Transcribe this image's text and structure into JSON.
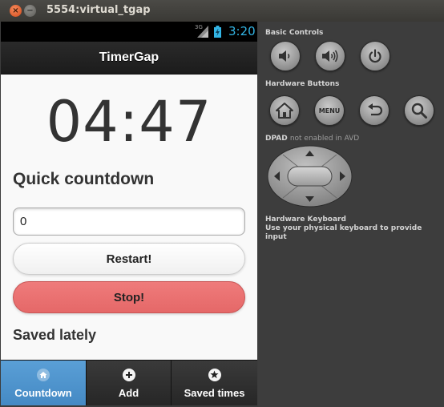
{
  "window": {
    "title": "5554:virtual_tgap",
    "close_glyph": "×",
    "minimize_glyph": "−"
  },
  "statusbar": {
    "network": "3G",
    "time": "3:20",
    "time_color": "#33b5e5"
  },
  "app": {
    "title": "TimerGap",
    "timer": "04:47",
    "quick_title": "Quick countdown",
    "countdown_value": "0",
    "restart_label": "Restart!",
    "stop_label": "Stop!",
    "saved_title": "Saved lately",
    "stop_color": "#e86f6f",
    "active_tab_color": "#4f95d0"
  },
  "tabs": [
    {
      "label": "Countdown",
      "icon": "home-icon",
      "active": true
    },
    {
      "label": "Add",
      "icon": "plus-icon",
      "active": false
    },
    {
      "label": "Saved times",
      "icon": "star-icon",
      "active": false
    }
  ],
  "panel": {
    "basic_controls": "Basic Controls",
    "hardware_buttons": "Hardware Buttons",
    "dpad_title": "DPAD",
    "dpad_note": "not enabled in AVD",
    "hardware_keyboard": "Hardware Keyboard",
    "keyboard_note": "Use your physical keyboard to provide input",
    "menu_label": "MENU",
    "basic_buttons": [
      "volume-down-icon",
      "volume-up-icon",
      "power-icon"
    ],
    "hardware_button_icons": [
      "home-icon",
      "menu-button",
      "back-icon",
      "search-icon"
    ]
  }
}
